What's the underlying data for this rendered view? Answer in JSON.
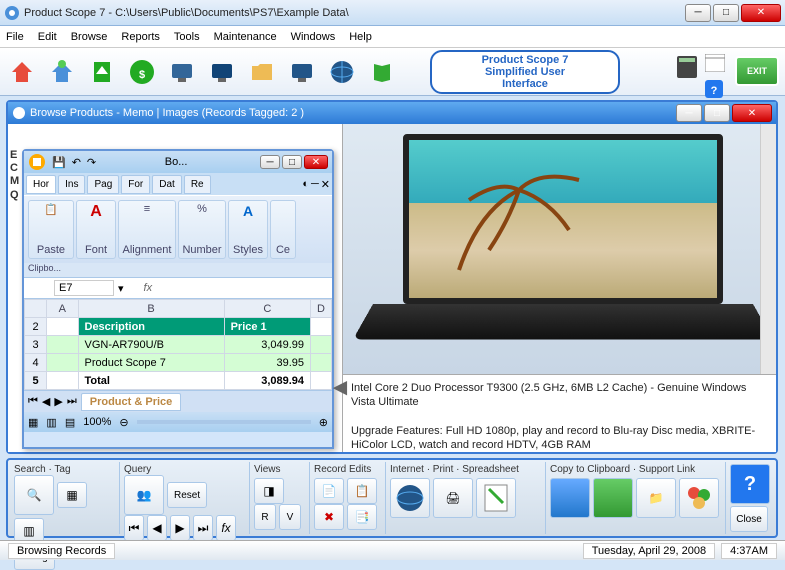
{
  "title": "Product Scope 7  -  C:\\Users\\Public\\Documents\\PS7\\Example Data\\",
  "menu": [
    "File",
    "Edit",
    "Browse",
    "Reports",
    "Tools",
    "Maintenance",
    "Windows",
    "Help"
  ],
  "badge": {
    "l1": "Product Scope 7",
    "l2": "Simplified User",
    "l3": "Interface"
  },
  "exit": "EXIT",
  "subwin_title": "Browse Products - Memo | Images  (Records Tagged:  2 )",
  "excel": {
    "title": "Bo...",
    "tabs": [
      "Hor",
      "Ins",
      "Pag",
      "For",
      "Dat",
      "Re"
    ],
    "ribbon": [
      "Paste",
      "Font",
      "Alignment",
      "Number",
      "Styles",
      "Ce"
    ],
    "clipb": "Clipbo...",
    "namebox": "E7",
    "cols": [
      "",
      "A",
      "B",
      "C",
      "D"
    ],
    "hdr": {
      "b": "Description",
      "c": "Price 1"
    },
    "rows": [
      {
        "n": "2"
      },
      {
        "n": "3",
        "b": "VGN-AR790U/B",
        "c": "3,049.99"
      },
      {
        "n": "4",
        "b": "Product Scope 7",
        "c": "39.95"
      },
      {
        "n": "5",
        "b": "Total",
        "c": "3,089.94"
      }
    ],
    "sheet": "Product & Price",
    "zoom": "100%"
  },
  "desc": {
    "l1": "Intel Core 2 Duo Processor T9300 (2.5 GHz, 6MB L2 Cache) - Genuine Windows Vista Ultimate",
    "l2": "Upgrade Features: Full HD 1080p, play and record to Blu-ray Disc media, XBRITE-HiColor LCD, watch and record HDTV, 4GB RAM"
  },
  "toolstrip": {
    "g1": "Search · Tag",
    "g2": "Query",
    "g3": "Views",
    "g4": "Record Edits",
    "g5": "Internet · Print · Spreadsheet",
    "g6": "Copy to Clipboard · Support Link",
    "untag": "Untag",
    "reset": "Reset",
    "r": "R",
    "v": "V",
    "close": "Close"
  },
  "status": {
    "l": "Browsing Records",
    "d": "Tuesday, April 29, 2008",
    "t": "4:37AM"
  }
}
